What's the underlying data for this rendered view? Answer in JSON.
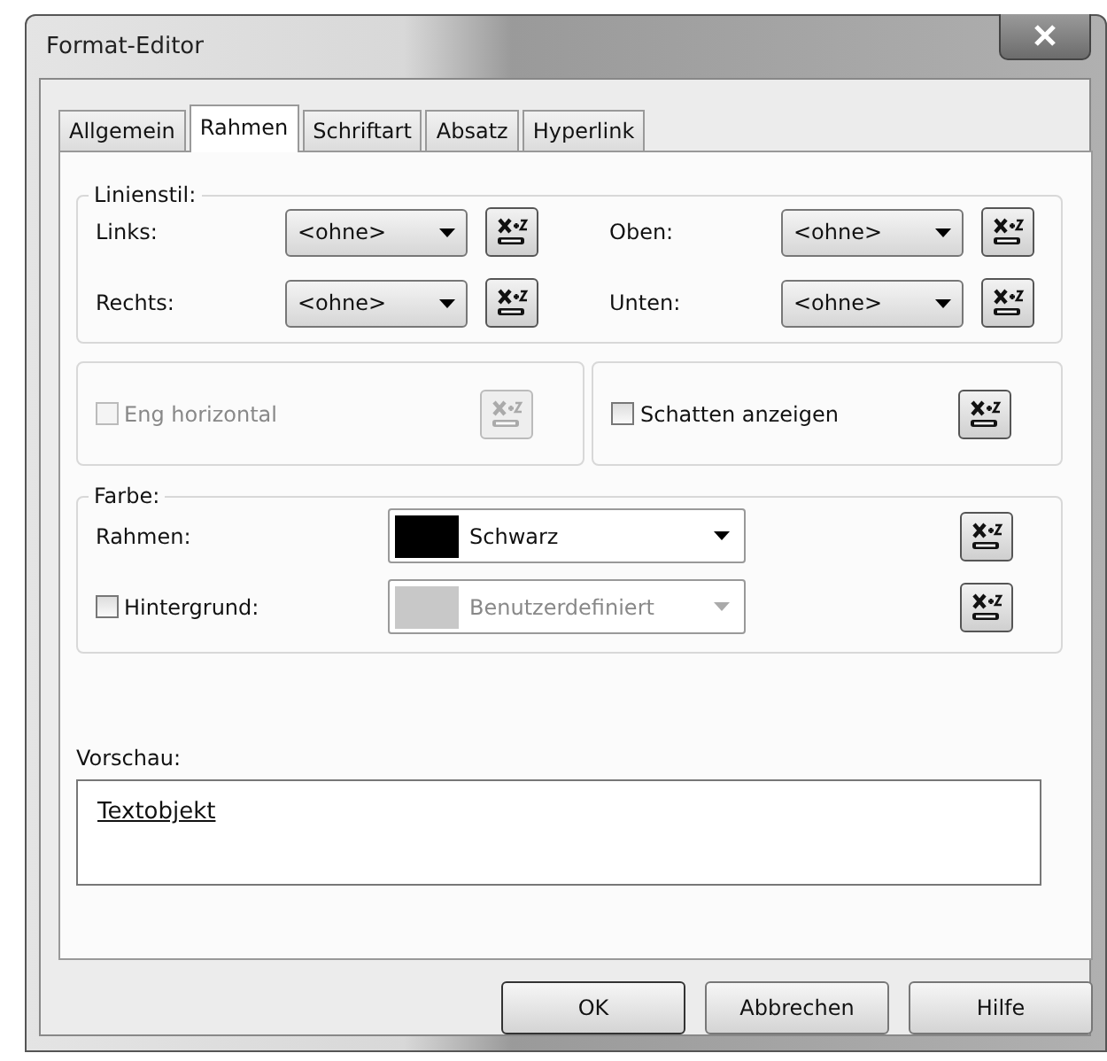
{
  "window": {
    "title": "Format-Editor"
  },
  "tabs": [
    {
      "label": "Allgemein",
      "selected": false
    },
    {
      "label": "Rahmen",
      "selected": true
    },
    {
      "label": "Schriftart",
      "selected": false
    },
    {
      "label": "Absatz",
      "selected": false
    },
    {
      "label": "Hyperlink",
      "selected": false
    }
  ],
  "line_style": {
    "label": "Linienstil:",
    "rows": [
      [
        {
          "label": "Links:",
          "value": "<ohne>"
        },
        {
          "label": "Oben:",
          "value": "<ohne>"
        }
      ],
      [
        {
          "label": "Rechts:",
          "value": "<ohne>"
        },
        {
          "label": "Unten:",
          "value": "<ohne>"
        }
      ]
    ]
  },
  "options": [
    {
      "label": "Eng horizontal",
      "checked": false,
      "disabled": true
    },
    {
      "label": "Schatten anzeigen",
      "checked": false,
      "disabled": false
    }
  ],
  "color": {
    "label": "Farbe:",
    "rows": [
      {
        "kind": "label",
        "label": "Rahmen:",
        "value": "Schwarz",
        "color": "#000000",
        "disabled": false
      },
      {
        "kind": "checkbox",
        "label": "Hintergrund:",
        "checked": false,
        "value": "Benutzerdefiniert",
        "color": "#c8c8c8",
        "disabled": true
      }
    ]
  },
  "preview": {
    "label": "Vorschau:",
    "text": "Textobjekt"
  },
  "buttons": [
    {
      "label": "OK",
      "default": true
    },
    {
      "label": "Abbrechen",
      "default": false
    },
    {
      "label": "Hilfe",
      "default": false
    }
  ]
}
